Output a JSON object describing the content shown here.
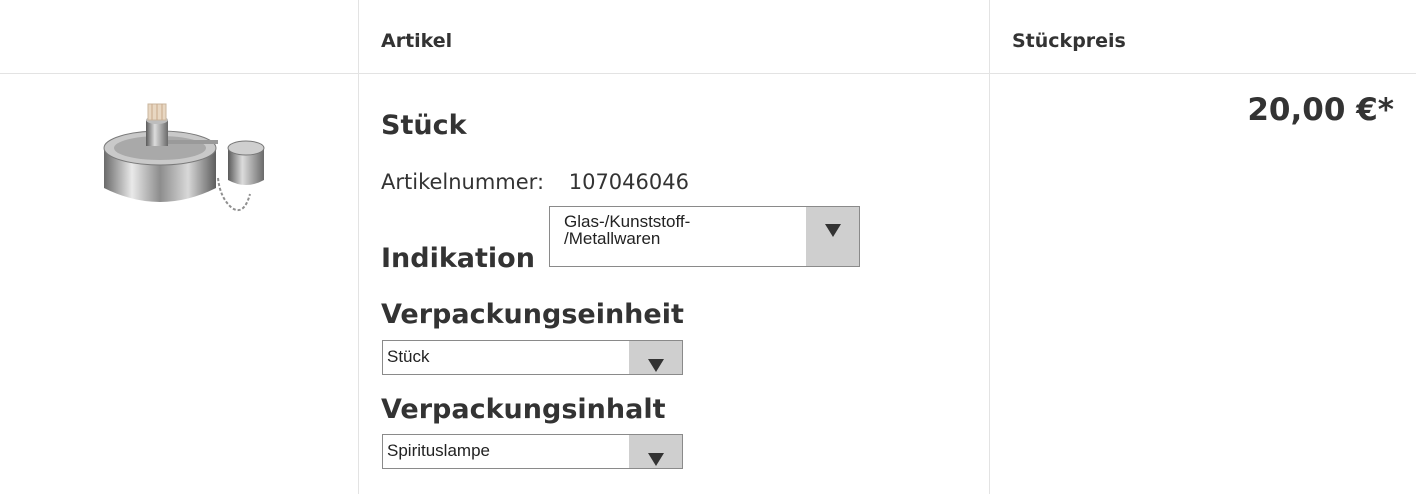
{
  "table": {
    "headers": {
      "article": "Artikel",
      "unit_price": "Stückpreis"
    }
  },
  "product": {
    "image_icon": "spirit-lamp-image",
    "title": "Stück",
    "article_number_label": "Artikelnummer:",
    "article_number": "107046046",
    "price": "20,00 €*"
  },
  "options": {
    "indikation": {
      "label": "Indikation",
      "selected": "Glas-/Kunststoff-\n/Metallwaren"
    },
    "verpackungseinheit": {
      "label": "Verpackungseinheit",
      "selected": "Stück"
    },
    "verpackungsinhalt": {
      "label": "Verpackungsinhalt",
      "selected": "Spirituslampe"
    }
  }
}
